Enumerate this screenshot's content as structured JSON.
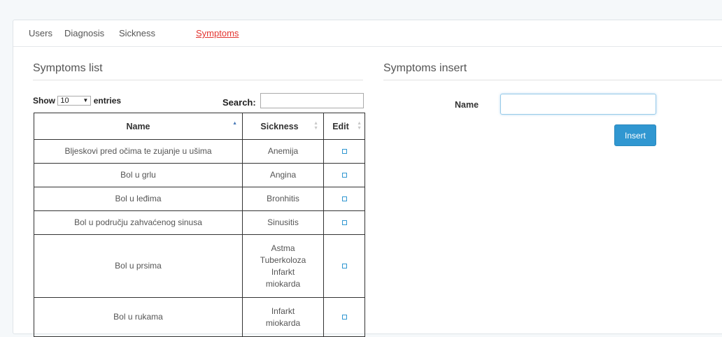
{
  "nav": {
    "tabs": [
      {
        "label": "Users"
      },
      {
        "label": "Diagnosis"
      },
      {
        "label": "Sickness"
      },
      {
        "label": "Symptoms",
        "active": true
      }
    ]
  },
  "list": {
    "title": "Symptoms list",
    "show_prefix": "Show",
    "show_value": "10",
    "show_suffix": "entries",
    "search_label": "Search:",
    "columns": [
      "Name",
      "Sickness",
      "Edit"
    ],
    "rows": [
      {
        "name": "Bljeskovi pred očima te zujanje u ušima",
        "sickness": [
          "Anemija"
        ]
      },
      {
        "name": "Bol u grlu",
        "sickness": [
          "Angina"
        ]
      },
      {
        "name": "Bol u leđima",
        "sickness": [
          "Bronhitis"
        ]
      },
      {
        "name": "Bol u području zahvaćenog sinusa",
        "sickness": [
          "Sinusitis"
        ]
      },
      {
        "name": "Bol u prsima",
        "sickness": [
          "Astma",
          "Tuberkoloza",
          "Infarkt",
          "miokarda"
        ]
      },
      {
        "name": "Bol u rukama",
        "sickness": [
          "Infarkt",
          "miokarda"
        ]
      }
    ]
  },
  "insert": {
    "title": "Symptoms insert",
    "name_label": "Name",
    "name_value": "",
    "button_label": "Insert"
  },
  "colors": {
    "active_tab": "#e3342f",
    "button": "#3097d1",
    "background": "#f5f8fa"
  }
}
